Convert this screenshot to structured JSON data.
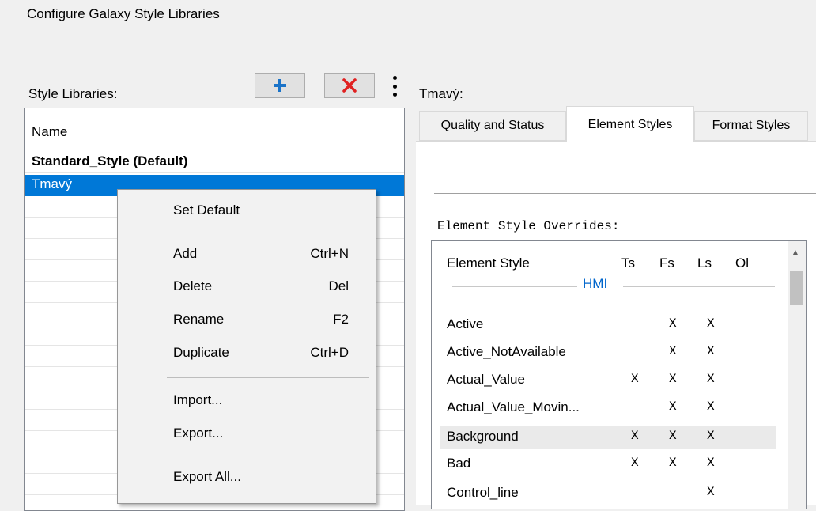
{
  "window": {
    "title": "Configure Galaxy Style Libraries"
  },
  "libraries": {
    "label": "Style Libraries:",
    "column_header": "Name",
    "items": [
      {
        "name": "Standard_Style (Default)",
        "is_default": true
      },
      {
        "name": "Tmavý",
        "selected": true
      }
    ]
  },
  "toolbar": {
    "add_icon": "plus-icon",
    "delete_icon": "close-icon",
    "more_icon": "more-vertical-icon"
  },
  "context_menu": {
    "items": [
      {
        "label": "Set Default",
        "shortcut": ""
      },
      {
        "label": "Add",
        "shortcut": "Ctrl+N"
      },
      {
        "label": "Delete",
        "shortcut": "Del"
      },
      {
        "label": "Rename",
        "shortcut": "F2"
      },
      {
        "label": "Duplicate",
        "shortcut": "Ctrl+D"
      },
      {
        "label": "Import...",
        "shortcut": ""
      },
      {
        "label": "Export...",
        "shortcut": ""
      },
      {
        "label": "Export All...",
        "shortcut": ""
      }
    ]
  },
  "detail": {
    "title": "Tmavý:",
    "tabs": [
      {
        "label": "Quality and Status",
        "active": false
      },
      {
        "label": "Element Styles",
        "active": true
      },
      {
        "label": "Format Styles",
        "active": false
      }
    ],
    "overrides_label": "Element Style Overrides:",
    "columns": [
      "Element Style",
      "Ts",
      "Fs",
      "Ls",
      "Ol"
    ],
    "group": "HMI",
    "rows": [
      {
        "name": "Active",
        "ts": "",
        "fs": "X",
        "ls": "X",
        "ol": ""
      },
      {
        "name": "Active_NotAvailable",
        "ts": "",
        "fs": "X",
        "ls": "X",
        "ol": ""
      },
      {
        "name": "Actual_Value",
        "ts": "X",
        "fs": "X",
        "ls": "X",
        "ol": ""
      },
      {
        "name": "Actual_Value_Movin...",
        "ts": "",
        "fs": "X",
        "ls": "X",
        "ol": ""
      },
      {
        "name": "Background",
        "ts": "X",
        "fs": "X",
        "ls": "X",
        "ol": "",
        "highlighted": true
      },
      {
        "name": "Bad",
        "ts": "X",
        "fs": "X",
        "ls": "X",
        "ol": ""
      },
      {
        "name": "Control_line",
        "ts": "",
        "fs": "",
        "ls": "X",
        "ol": ""
      }
    ]
  },
  "colors": {
    "selection": "#0078d7",
    "group_header": "#0066cc",
    "window_bg": "#f0f0f0"
  }
}
